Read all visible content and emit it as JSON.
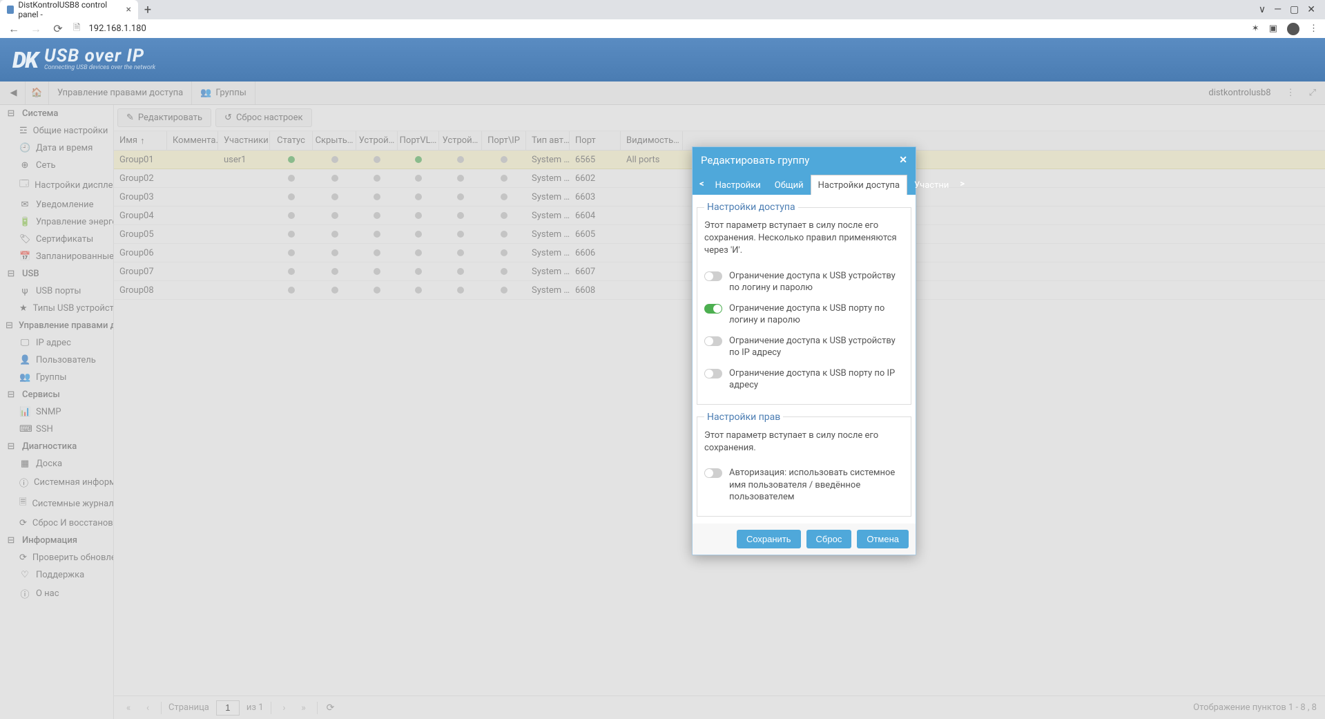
{
  "browser": {
    "tab_title": "DistKontrolUSB8 control panel - ",
    "url": "192.168.1.180",
    "window_controls": {
      "min": "—",
      "max": "▢",
      "close": "✕",
      "chevron": "∨"
    }
  },
  "header": {
    "logo_mark": "DK",
    "logo_main": "USB over IP",
    "logo_sub": "Connecting USB devices over the network"
  },
  "toolbar": {
    "collapse": "◀",
    "home": "⌂",
    "access_rights": "Управление правами доступа",
    "groups": "Группы",
    "user": "distkontrolusb8"
  },
  "sidebar": {
    "sections": [
      {
        "label": "Система",
        "icon": "⊟",
        "children": [
          {
            "label": "Общие настройки",
            "icon": "☲"
          },
          {
            "label": "Дата и время",
            "icon": "🕘"
          },
          {
            "label": "Сеть",
            "icon": "⊕"
          },
          {
            "label": "Настройки дисплея",
            "icon": "🗔"
          },
          {
            "label": "Уведомление",
            "icon": "✉"
          },
          {
            "label": "Управление энергопотр",
            "icon": "🔋"
          },
          {
            "label": "Сертификаты",
            "icon": "🏷"
          },
          {
            "label": "Запланированные задан",
            "icon": "📅"
          }
        ]
      },
      {
        "label": "USB",
        "icon": "⊟",
        "children": [
          {
            "label": "USB порты",
            "icon": "ψ"
          },
          {
            "label": "Типы USB устройств",
            "icon": "★"
          }
        ]
      },
      {
        "label": "Управление правами досту",
        "icon": "⊟",
        "children": [
          {
            "label": "IP адрес",
            "icon": "🖵"
          },
          {
            "label": "Пользователь",
            "icon": "👤"
          },
          {
            "label": "Группы",
            "icon": "👥"
          }
        ]
      },
      {
        "label": "Сервисы",
        "icon": "⊟",
        "children": [
          {
            "label": "SNMP",
            "icon": "📊"
          },
          {
            "label": "SSH",
            "icon": "⌨"
          }
        ]
      },
      {
        "label": "Диагностика",
        "icon": "⊟",
        "children": [
          {
            "label": "Доска",
            "icon": "▦"
          },
          {
            "label": "Системная информация",
            "icon": "ⓘ"
          },
          {
            "label": "Системные журналы",
            "icon": "🗏"
          },
          {
            "label": "Сброс И восстановление",
            "icon": "⟳"
          }
        ]
      },
      {
        "label": "Информация",
        "icon": "⊟",
        "children": [
          {
            "label": "Проверить обновления",
            "icon": "⟳"
          },
          {
            "label": "Поддержка",
            "icon": "♡"
          },
          {
            "label": "О нас",
            "icon": "ⓘ"
          }
        ]
      }
    ]
  },
  "content_toolbar": {
    "edit": "Редактировать",
    "reset": "Сброс настроек"
  },
  "grid": {
    "columns": [
      "Имя",
      "Коммента…",
      "Участники",
      "Статус",
      "Скрыть…",
      "Устрой…",
      "ПортVL…",
      "Устрой…",
      "Порт\\IP",
      "Тип авт…",
      "Порт",
      "Видимость…"
    ],
    "sort_indicator": "↑",
    "rows": [
      {
        "name": "Group01",
        "comment": "",
        "users": "user1",
        "status": "on",
        "hide": "off",
        "dev": "off",
        "pvlan": "on",
        "dev2": "off",
        "pip": "off",
        "auth": "System …",
        "port": "6565",
        "vis": "All ports",
        "selected": true
      },
      {
        "name": "Group02",
        "comment": "",
        "users": "",
        "status": "off",
        "hide": "off",
        "dev": "off",
        "pvlan": "off",
        "dev2": "off",
        "pip": "off",
        "auth": "System …",
        "port": "6602",
        "vis": "",
        "selected": false
      },
      {
        "name": "Group03",
        "comment": "",
        "users": "",
        "status": "off",
        "hide": "off",
        "dev": "off",
        "pvlan": "off",
        "dev2": "off",
        "pip": "off",
        "auth": "System …",
        "port": "6603",
        "vis": "",
        "selected": false
      },
      {
        "name": "Group04",
        "comment": "",
        "users": "",
        "status": "off",
        "hide": "off",
        "dev": "off",
        "pvlan": "off",
        "dev2": "off",
        "pip": "off",
        "auth": "System …",
        "port": "6604",
        "vis": "",
        "selected": false
      },
      {
        "name": "Group05",
        "comment": "",
        "users": "",
        "status": "off",
        "hide": "off",
        "dev": "off",
        "pvlan": "off",
        "dev2": "off",
        "pip": "off",
        "auth": "System …",
        "port": "6605",
        "vis": "",
        "selected": false
      },
      {
        "name": "Group06",
        "comment": "",
        "users": "",
        "status": "off",
        "hide": "off",
        "dev": "off",
        "pvlan": "off",
        "dev2": "off",
        "pip": "off",
        "auth": "System …",
        "port": "6606",
        "vis": "",
        "selected": false
      },
      {
        "name": "Group07",
        "comment": "",
        "users": "",
        "status": "off",
        "hide": "off",
        "dev": "off",
        "pvlan": "off",
        "dev2": "off",
        "pip": "off",
        "auth": "System …",
        "port": "6607",
        "vis": "",
        "selected": false
      },
      {
        "name": "Group08",
        "comment": "",
        "users": "",
        "status": "off",
        "hide": "off",
        "dev": "off",
        "pvlan": "off",
        "dev2": "off",
        "pip": "off",
        "auth": "System …",
        "port": "6608",
        "vis": "",
        "selected": false
      }
    ]
  },
  "pager": {
    "page_label": "Страница",
    "page": "1",
    "of_label": "из 1",
    "info": "Отображение пунктов 1 - 8 , 8"
  },
  "dialog": {
    "title": "Редактировать группу",
    "tabs": [
      "Настройки",
      "Общий",
      "Настройки доступа",
      "Участни"
    ],
    "active_tab": 2,
    "scroll_left": "<",
    "scroll_right": ">",
    "section_access": {
      "legend": "Настройки доступа",
      "text": "Этот параметр вступает в силу после его сохранения. Несколько правил применяются через 'И'.",
      "opts": [
        {
          "label": "Ограничение доступа к USB устройству по логину и паролю",
          "on": false
        },
        {
          "label": "Ограничение доступа к USB порту по логину и паролю",
          "on": true
        },
        {
          "label": "Ограничение доступа к USB устройству по IP адресу",
          "on": false
        },
        {
          "label": "Ограничение доступа к USB порту по IP адресу",
          "on": false
        }
      ]
    },
    "section_rights": {
      "legend": "Настройки прав",
      "text": "Этот параметр вступает в силу после его сохранения.",
      "opts": [
        {
          "label": "Авторизация: использовать системное имя пользователя / введённое пользователем",
          "on": false
        }
      ]
    },
    "buttons": {
      "save": "Сохранить",
      "reset": "Сброс",
      "cancel": "Отмена"
    }
  }
}
